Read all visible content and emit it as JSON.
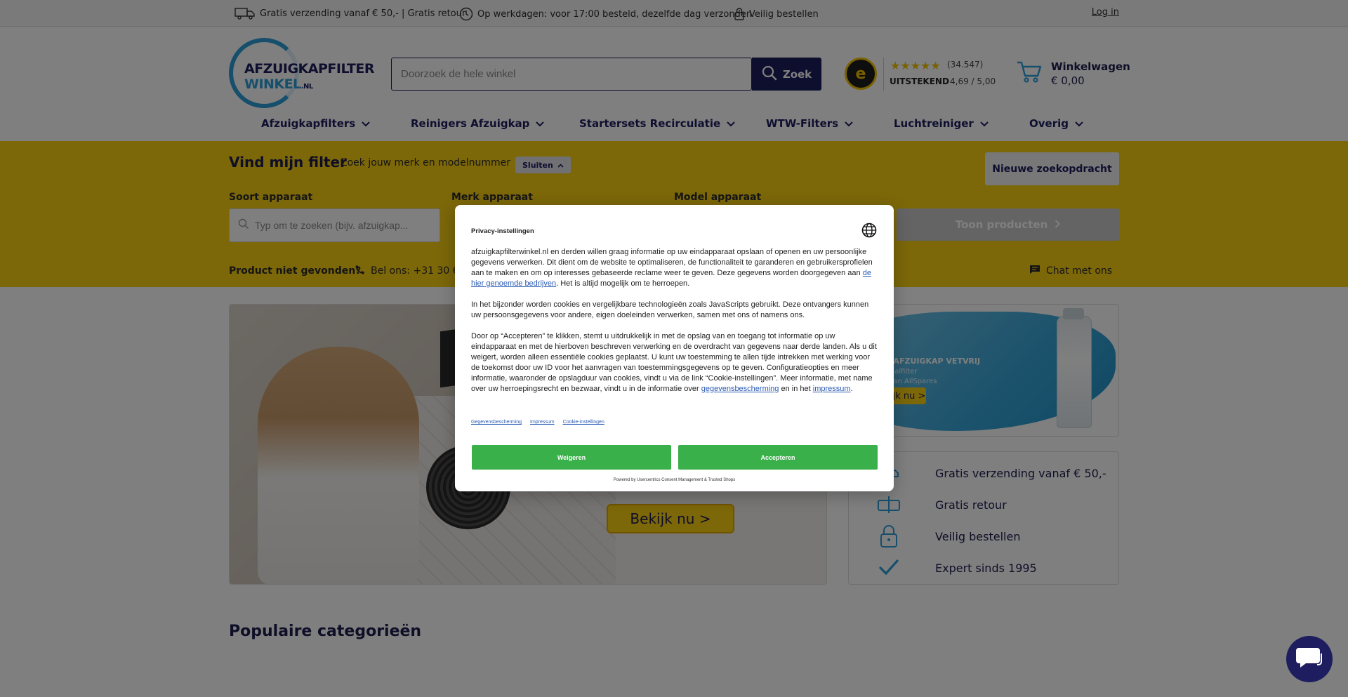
{
  "topbar": {
    "usp_shipping": "Gratis verzending vanaf € 50,- | Gratis retour",
    "usp_sameday": "Op werkdagen: voor 17:00 besteld, dezelfde dag verzonden",
    "usp_secure": "Veilig bestellen",
    "login": "Log in"
  },
  "header": {
    "logo_line1": "AFZUIGKAPFILTER",
    "logo_line2": "WINKEL",
    "logo_tld": ".NL",
    "search_placeholder": "Doorzoek de hele winkel",
    "search_button": "Zoek",
    "trust_seal_letter": "e",
    "trust_stars": "★★★★★",
    "trust_count": "(34.547)",
    "trust_label": "UITSTEKEND",
    "trust_score": "4,69 / 5,00",
    "cart_title": "Winkelwagen",
    "cart_amount": "€ 0,00"
  },
  "nav": {
    "items": [
      {
        "label": "Afzuigkapfilters"
      },
      {
        "label": "Reinigers Afzuigkap"
      },
      {
        "label": "Startersets Recirculatie"
      },
      {
        "label": "WTW-Filters"
      },
      {
        "label": "Luchtreiniger"
      },
      {
        "label": "Overig"
      }
    ]
  },
  "finder": {
    "title": "Vind mijn filter",
    "subtitle": "Zoek jouw merk en modelnummer",
    "close": "Sluiten",
    "new_search": "Nieuwe zoekopdracht",
    "label_type": "Soort apparaat",
    "label_brand": "Merk apparaat",
    "label_model": "Model apparaat",
    "type_placeholder": "Typ om te zoeken (bijv. afzuigkap...",
    "show_products": "Toon producten",
    "not_found": "Product niet gevonden?",
    "phone": "Bel ons: +31 30 698",
    "chat": "Chat met ons"
  },
  "hero": {
    "cta": "Bekijk nu >"
  },
  "promo": {
    "title": "D DE AFZUIGKAP VETVRIJ",
    "line1": "e metaalfilter",
    "line2": "etter van AllSpares",
    "cta": "Bekijk nu >"
  },
  "usps": [
    {
      "label": "Gratis verzending vanaf € 50,-"
    },
    {
      "label": "Gratis retour"
    },
    {
      "label": "Veilig bestellen"
    },
    {
      "label": "Expert sinds 1995"
    }
  ],
  "popular_title": "Populaire categorieën",
  "consent": {
    "title": "Privacy-instellingen",
    "p1_a": "afzuigkapfilterwinkel.nl en derden willen graag informatie op uw eindapparaat opslaan of openen en uw persoonlijke gegevens verwerken. Dit dient om de website te optimaliseren, de functionaliteit te garanderen en gebruikersprofielen aan te maken en om op interesses gebaseerde reclame weer te geven. Deze gegevens worden doorgegeven aan ",
    "p1_link": "de hier genoemde bedrijven",
    "p1_b": ". Het is altijd mogelijk om te herroepen.",
    "p2": "In het bijzonder worden cookies en vergelijkbare technologieën zoals JavaScripts gebruikt. Deze ontvangers kunnen uw persoonsgegevens voor andere, eigen doeleinden verwerken, samen met ons of namens ons.",
    "p3_a": "Door op “Accepteren” te klikken, stemt u uitdrukkelijk in met de opslag van en toegang tot informatie op uw eindapparaat en met de hierboven beschreven verwerking en de overdracht van gegevens naar derde landen. Als u dit weigert, worden alleen essentiële cookies geplaatst. U kunt uw toestemming te allen tijde intrekken met werking voor de toekomst door uw ID voor het aanvragen van toestemmingsgegevens op te geven. Configuratieopties en meer informatie, waaronder de opslagduur van cookies, vindt u via de link “Cookie-instellingen”. Meer informatie, met name over uw herroepingsrecht en bezwaar, vindt u in de informatie over ",
    "p3_link1": "gegevensbescherming",
    "p3_mid": " en in het ",
    "p3_link2": "impressum",
    "p3_end": ".",
    "link_privacy": "Gegevensbescherming",
    "link_impressum": "Impressum",
    "link_cookies": "Cookie-instellingen",
    "decline": "Weigeren",
    "accept": "Accepteren",
    "footer": "Powered by Usercentrics Consent Management & Trusted Shops"
  },
  "colors": {
    "brand_navy": "#1d1d5f",
    "brand_blue": "#2d9fd8",
    "finder_yellow": "#f9cf12",
    "consent_green": "#39b04a"
  }
}
